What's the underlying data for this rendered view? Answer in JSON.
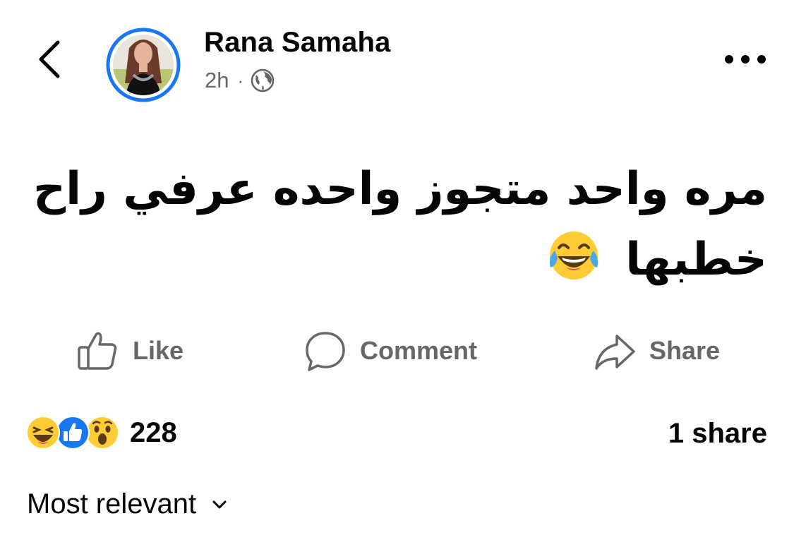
{
  "post": {
    "author_name": "Rana Samaha",
    "time": "2h",
    "separator": "·",
    "audience_icon": "globe-icon",
    "text": "مره واحد متجوز واحده عرفي راح خطبها",
    "text_emoji": "face-with-tears-of-joy",
    "accent_color": "#1877f2"
  },
  "actions": {
    "like_label": "Like",
    "comment_label": "Comment",
    "share_label": "Share"
  },
  "engagement": {
    "reaction_icons": [
      "haha-reaction",
      "like-reaction",
      "wow-reaction"
    ],
    "reaction_count": "228",
    "share_count": "1 share"
  },
  "comments": {
    "sort_label": "Most relevant"
  }
}
